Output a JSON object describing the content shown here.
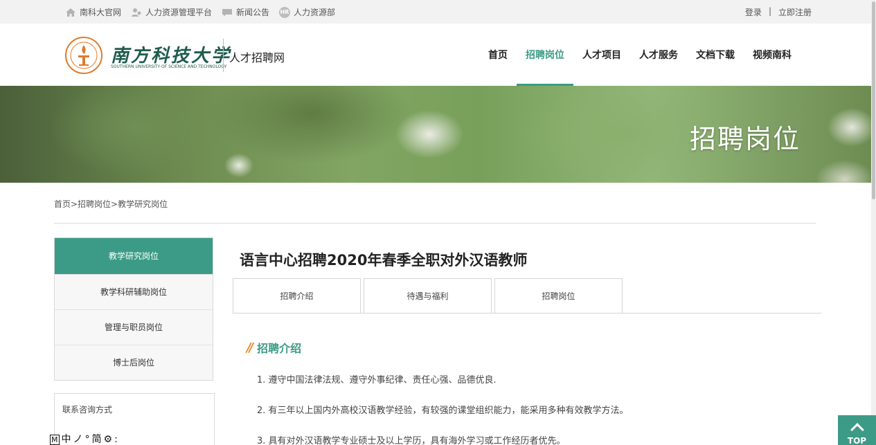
{
  "topbar": {
    "links": [
      {
        "label": "南科大官网",
        "icon": "home-icon"
      },
      {
        "label": "人力资源管理平台",
        "icon": "users-icon"
      },
      {
        "label": "新闻公告",
        "icon": "chat-icon"
      },
      {
        "label": "人力资源部",
        "icon": "hr-badge-icon",
        "badge": "HR"
      }
    ],
    "login": "登录",
    "separator": "|",
    "register": "立即注册"
  },
  "header": {
    "logo_cn": "南方科技大学",
    "logo_en": "SOUTHERN UNIVERSITY OF SCIENCE AND TECHNOLOGY",
    "site_name": "人才招聘网",
    "nav": [
      "首页",
      "招聘岗位",
      "人才项目",
      "人才服务",
      "文档下载",
      "视频南科"
    ],
    "active_nav": "招聘岗位"
  },
  "banner": {
    "title": "招聘岗位"
  },
  "breadcrumb": "首页>招聘岗位>教学研究岗位",
  "sidebar": {
    "items": [
      "教学研究岗位",
      "教学科研辅助岗位",
      "管理与职员岗位",
      "博士后岗位"
    ],
    "contact_title": "联系咨询方式"
  },
  "main": {
    "title": "语言中心招聘2020年春季全职对外汉语教师",
    "tabs": [
      "招聘介绍",
      "待遇与福利",
      "招聘岗位"
    ],
    "section_mark": "//",
    "section_label": "招聘介绍",
    "paragraphs": [
      "1. 遵守中国法律法规、遵守外事纪律、责任心强、品德优良.",
      "2. 有三年以上国内外高校汉语教学经验，有较强的课堂组织能力，能采用多种有效教学方法。",
      "3. 具有对外汉语教学专业硕士及以上学历，具有海外学习或工作经历者优先。"
    ]
  },
  "top_button": {
    "label": "TOP"
  },
  "ime_bar": [
    "M",
    "中",
    "ノ",
    "°",
    "简",
    "⚙",
    ":"
  ],
  "colors": {
    "accent": "#3c9b86",
    "orange": "#e88a2b",
    "logo_green": "#1f5c4d"
  }
}
